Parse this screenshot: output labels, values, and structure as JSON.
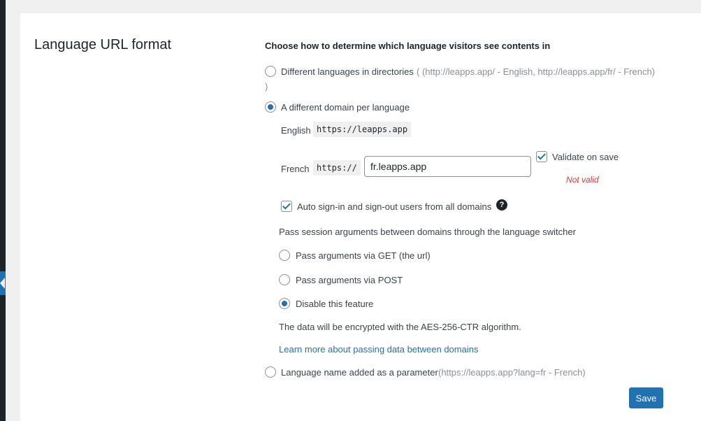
{
  "section": {
    "title": "Language URL format",
    "heading": "Choose how to determine which language visitors see contents in"
  },
  "options": {
    "directories": {
      "label": "Different languages in directories",
      "hint_line1": "( (http://leapps.app/ - English, http://leapps.app/fr/ - French)",
      "hint_line2": ")",
      "checked": false
    },
    "domains": {
      "label": "A different domain per language",
      "checked": true,
      "english": {
        "label": "English",
        "url": "https://leapps.app"
      },
      "french": {
        "label": "French",
        "prefix": "https://",
        "value": "fr.leapps.app",
        "validate_label": "Validate on save",
        "validate_checked": true,
        "error": "Not valid"
      },
      "auto_sign": {
        "label": "Auto sign-in and sign-out users from all domains",
        "checked": true,
        "help_icon": "?"
      },
      "session_desc": "Pass session arguments between domains through the language switcher",
      "session_options": [
        {
          "label": "Pass arguments via GET (the url)",
          "checked": false
        },
        {
          "label": "Pass arguments via POST",
          "checked": false
        },
        {
          "label": "Disable this feature",
          "checked": true
        }
      ],
      "encryption_note": "The data will be encrypted with the AES-256-CTR algorithm.",
      "learn_more": "Learn more about passing data between domains"
    },
    "parameter": {
      "label": "Language name added as a parameter",
      "hint": "(https://leapps.app?lang=fr - French)",
      "checked": false
    }
  },
  "buttons": {
    "save": "Save"
  },
  "colors": {
    "accent": "#2271b1",
    "error": "#d63638",
    "sidebar": "#1d2327"
  }
}
